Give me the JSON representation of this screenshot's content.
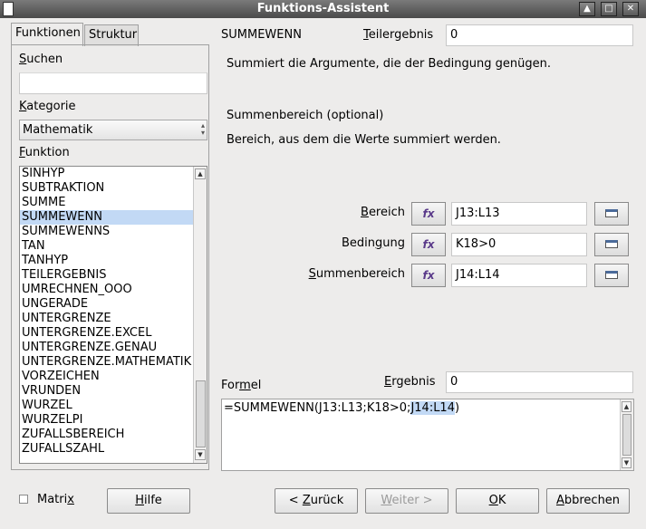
{
  "window": {
    "title": "Funktions-Assistent"
  },
  "tabs": [
    {
      "label": "Funktionen"
    },
    {
      "label": "Struktur"
    }
  ],
  "left": {
    "search_label": "Suchen",
    "search_value": "",
    "category_label": "Kategorie",
    "category_value": "Mathematik",
    "function_label": "Funktion",
    "functions": [
      "SINHYP",
      "SUBTRAKTION",
      "SUMME",
      "SUMMEWENN",
      "SUMMEWENNS",
      "TAN",
      "TANHYP",
      "TEILERGEBNIS",
      "UMRECHNEN_OOO",
      "UNGERADE",
      "UNTERGRENZE",
      "UNTERGRENZE.EXCEL",
      "UNTERGRENZE.GENAU",
      "UNTERGRENZE.MATHEMATIK",
      "VORZEICHEN",
      "VRUNDEN",
      "WURZEL",
      "WURZELPI",
      "ZUFALLSBEREICH",
      "ZUFALLSZAHL"
    ],
    "selected_function": "SUMMEWENN"
  },
  "right": {
    "function_name": "SUMMEWENN",
    "subresult_label": "Teilergebnis",
    "subresult_value": "0",
    "description": "Summiert die Argumente, die der Bedingung genügen.",
    "arg_title": "Summenbereich (optional)",
    "arg_description": "Bereich, aus dem die Werte summiert werden.",
    "args": [
      {
        "label": "Bereich",
        "value": "J13:L13"
      },
      {
        "label": "Bedingung",
        "value": "K18>0"
      },
      {
        "label": "Summenbereich",
        "value": "J14:L14"
      }
    ],
    "fx_label": "fx",
    "formula_label": "Formel",
    "result_label": "Ergebnis",
    "result_value": "0",
    "formula_prefix": "=SUMMEWENN(J13:L13;K18>0;",
    "formula_highlight": "J14:L14",
    "formula_suffix": ")"
  },
  "footer": {
    "matrix_label": "Matrix",
    "help": "Hilfe",
    "back": "< Zurück",
    "next": "Weiter >",
    "ok": "OK",
    "cancel": "Abbrechen"
  },
  "colors": {
    "selection": "#c2d9f5",
    "titlebar": "#5a5a5a"
  }
}
